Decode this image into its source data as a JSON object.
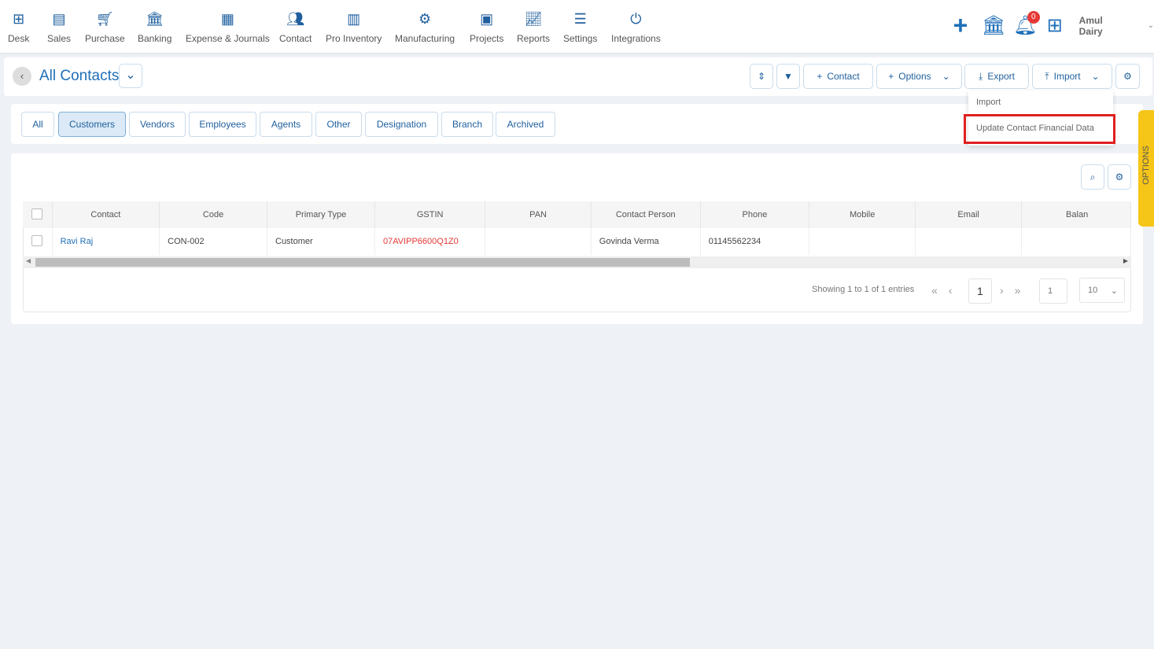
{
  "nav": [
    {
      "label": "Desk",
      "icon": "desk-grid-icon"
    },
    {
      "label": "Sales",
      "icon": "sales-receipt-icon"
    },
    {
      "label": "Purchase",
      "icon": "cart-icon"
    },
    {
      "label": "Banking",
      "icon": "bank-icon"
    },
    {
      "label": "Expense & Journals",
      "icon": "journal-icon"
    },
    {
      "label": "Contact",
      "icon": "contact-people-icon"
    },
    {
      "label": "Pro Inventory",
      "icon": "inventory-icon"
    },
    {
      "label": "Manufacturing",
      "icon": "manufacturing-icon"
    },
    {
      "label": "Projects",
      "icon": "projects-icon"
    },
    {
      "label": "Reports",
      "icon": "reports-icon"
    },
    {
      "label": "Settings",
      "icon": "settings-sliders-icon"
    },
    {
      "label": "Integrations",
      "icon": "integrations-icon"
    }
  ],
  "header_right": {
    "notifications": "0",
    "user": "Amul Dairy"
  },
  "page": {
    "title": "All Contacts"
  },
  "toolbar": {
    "contact": "Contact",
    "options": "Options",
    "export": "Export",
    "import": "Import"
  },
  "import_menu": [
    "Import",
    "Update Contact Financial Data"
  ],
  "tabs": [
    "All",
    "Customers",
    "Vendors",
    "Employees",
    "Agents",
    "Other",
    "Designation",
    "Branch",
    "Archived"
  ],
  "active_tab": "Customers",
  "table": {
    "columns": [
      "Contact",
      "Code",
      "Primary Type",
      "GSTIN",
      "PAN",
      "Contact Person",
      "Phone",
      "Mobile",
      "Email",
      "Balan"
    ],
    "rows": [
      [
        "Ravi Raj",
        "CON-002",
        "Customer",
        "07AVIPP6600Q1Z0",
        "",
        "Govinda Verma",
        "01145562234",
        "",
        "",
        ""
      ]
    ]
  },
  "pagination": {
    "info": "Showing 1 to 1 of 1 entries",
    "current": "1",
    "goto": "1",
    "page_size": "10"
  },
  "side_tab": "OPTIONS",
  "colors": {
    "accent": "#1f5f9e",
    "gstin": "#e53935",
    "highlight": "#e02020",
    "side_tab": "#f5c518"
  }
}
